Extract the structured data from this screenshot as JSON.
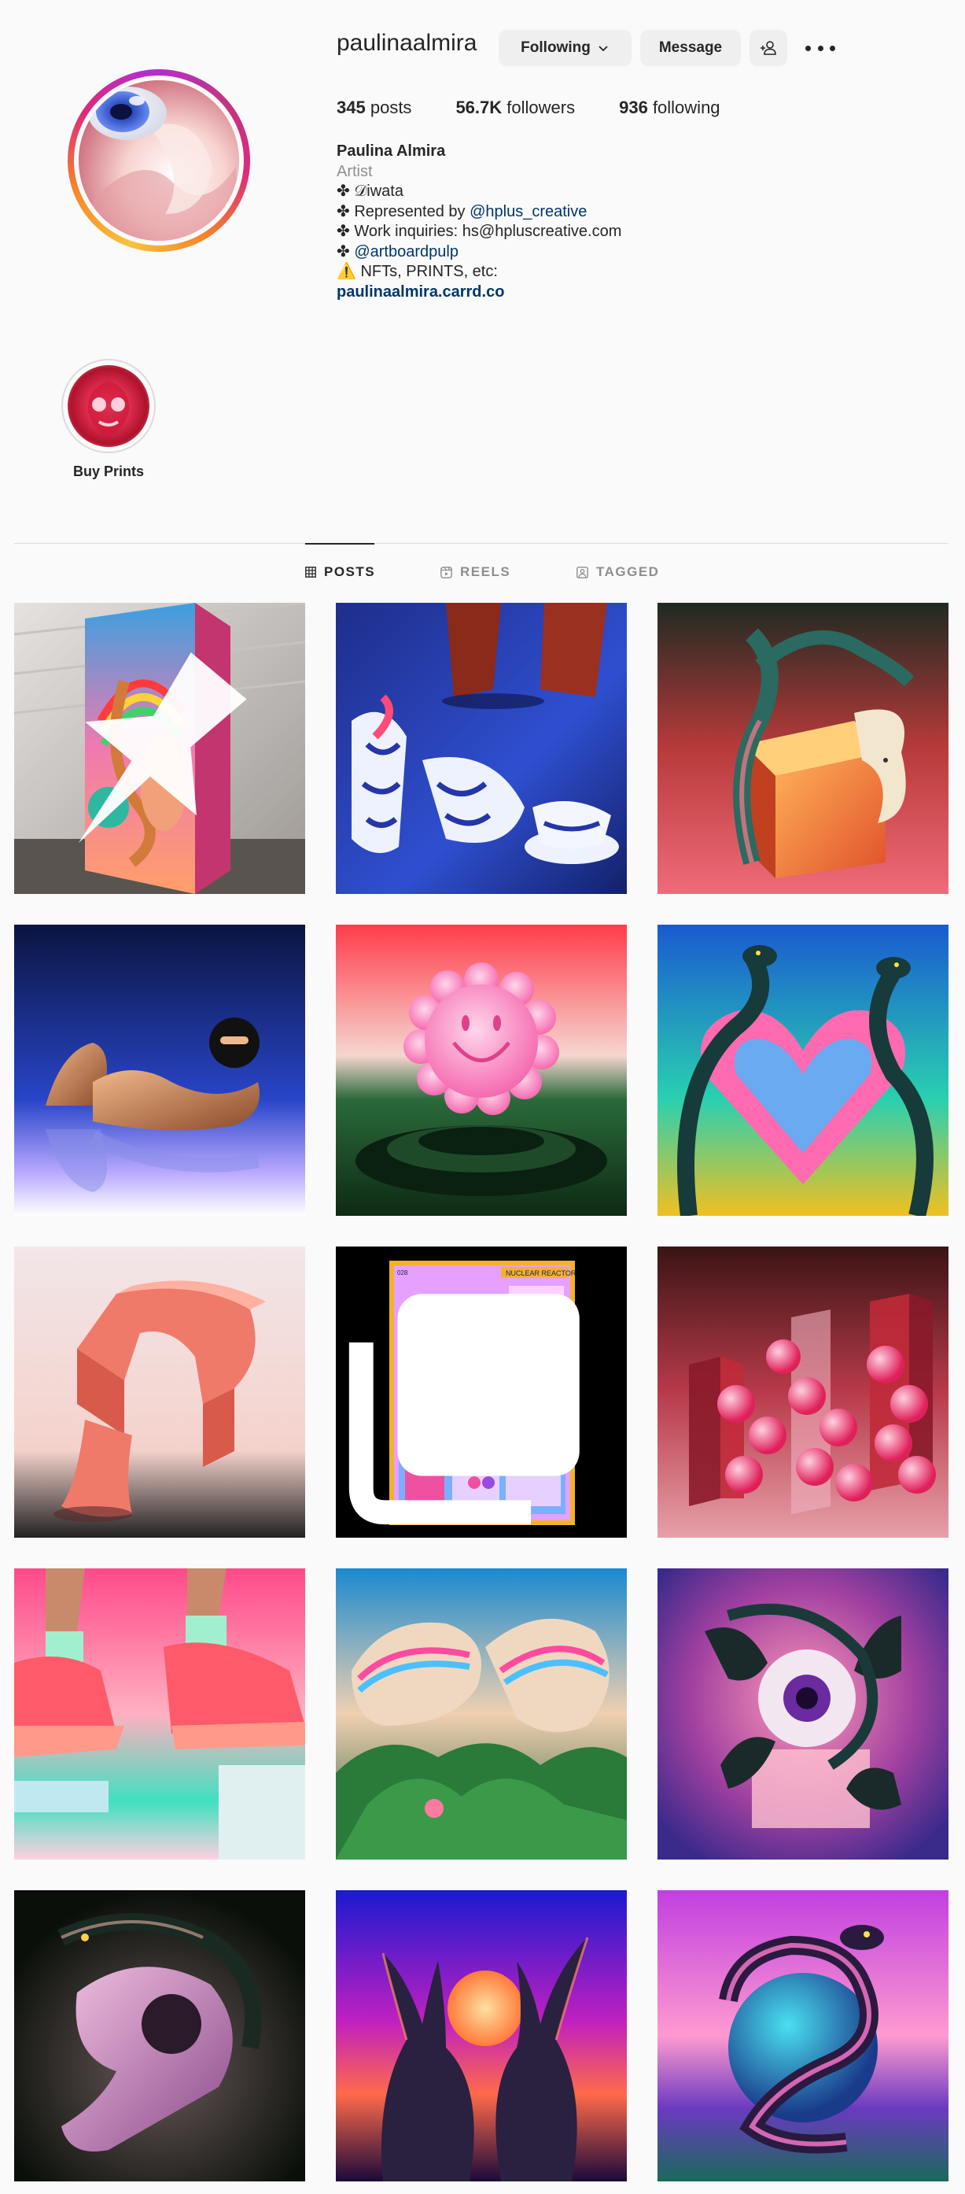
{
  "profile": {
    "username": "paulinaalmira",
    "following_button": "Following",
    "message_button": "Message",
    "stats": {
      "posts_count": "345",
      "posts_label": "posts",
      "followers_count": "56.7K",
      "followers_label": "followers",
      "following_count": "936",
      "following_label": "following"
    },
    "bio": {
      "name": "Paulina Almira",
      "category": "Artist",
      "line1_prefix": "✤ ",
      "line1": "𝒟iwata",
      "line2_prefix": "✤ Represented by ",
      "line2_link": "@hplus_creative",
      "line3": "✤ Work inquiries: hs@hpluscreative.com",
      "line4_prefix": "✤ ",
      "line4_link": "@artboardpulp",
      "line5": "⚠️ NFTs, PRINTS, etc:",
      "website": "paulinaalmira.carrd.co"
    }
  },
  "highlights": [
    {
      "label": "Buy Prints"
    }
  ],
  "tabs": {
    "posts": "POSTS",
    "reels": "REELS",
    "tagged": "TAGGED"
  },
  "icons": {
    "following_chevron": "chevron-down-icon",
    "add_user": "add-user-icon",
    "more": "more-options-icon",
    "posts_tab": "grid-icon",
    "reels_tab": "reels-icon",
    "tagged_tab": "tagged-icon",
    "pinned": "pin-icon",
    "carousel": "carousel-icon"
  },
  "colors": {
    "link": "#00376b",
    "secondary_text": "#8e8e8e",
    "button_bg": "#efefef",
    "divider": "#dbdbdb"
  }
}
